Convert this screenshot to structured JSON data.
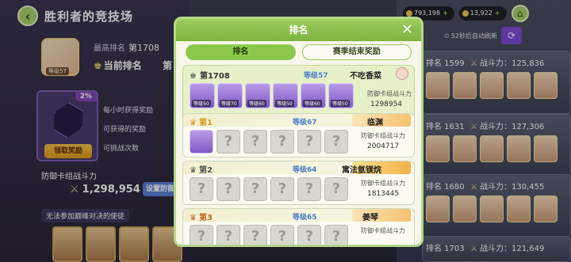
{
  "header": {
    "back_icon": "chevron-left-icon",
    "title": "胜利者的竞技场"
  },
  "profile": {
    "avatar_level": "等级57",
    "best_rank_label": "最高排名",
    "best_rank_value": "第1708",
    "current_rank_label": "当前排名",
    "current_rank_value_fragment": "第"
  },
  "reward": {
    "percent": "2%",
    "claim_label": "领取奖励",
    "hourly_label": "每小时获得奖励",
    "obtainable_label": "可获得的奖励",
    "challenge_label": "可挑战次数"
  },
  "defense": {
    "label": "防御卡组战斗力",
    "power": "1,298,954",
    "setup_label": "设置防御卡组"
  },
  "no_join_label": "无法参加巅峰对决的使徒",
  "currency": [
    {
      "value": "793,198"
    },
    {
      "value": "13,922"
    }
  ],
  "refresh_text": "52秒后自动刷新",
  "opponents": [
    {
      "rank": "排名 1599",
      "power_label": "战斗力：125,836"
    },
    {
      "rank": "排名 1631",
      "power_label": "战斗力：127,306"
    },
    {
      "rank": "排名 1680",
      "power_label": "战斗力：130,455"
    },
    {
      "rank": "排名 1703",
      "power_label": "战斗力：121,649"
    }
  ],
  "modal": {
    "title": "排名",
    "close_icon": "close-icon",
    "tabs": [
      "排名",
      "赛季结束奖励"
    ],
    "my_entry": {
      "rank": "第1708",
      "level": "等级57",
      "name": "不吃香菜",
      "power_label": "防御卡组战斗力",
      "power_value": "1298954",
      "team_tags": [
        "等级50",
        "等级70",
        "等级60",
        "等级50",
        "等级60",
        "等级50"
      ]
    },
    "entries": [
      {
        "rank": "第1",
        "level": "等级67",
        "name": "临渊",
        "power_label": "防御卡组战斗力",
        "power_value": "2004717"
      },
      {
        "rank": "第2",
        "level": "等级64",
        "name": "寓法氩镁烷",
        "power_label": "防御卡组战斗力",
        "power_value": "1813445"
      },
      {
        "rank": "第3",
        "level": "等级65",
        "name": "姜琴",
        "power_label": "防御卡组战斗力",
        "power_value": ""
      }
    ]
  },
  "colors": {
    "accent_green": "#8cc84b",
    "level_blue": "#4a7ec8",
    "claim_orange": "#e29a1a",
    "gem_purple": "#7c4bd3"
  }
}
